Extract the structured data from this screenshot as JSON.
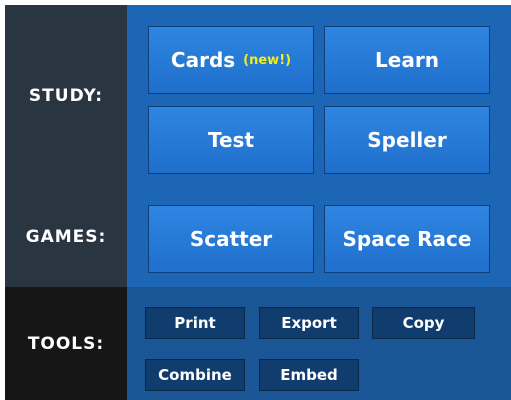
{
  "study": {
    "label": "STUDY:",
    "buttons": {
      "cards": "Cards",
      "cards_badge": "(new!)",
      "learn": "Learn",
      "test": "Test",
      "speller": "Speller"
    }
  },
  "games": {
    "label": "GAMES:",
    "buttons": {
      "scatter": "Scatter",
      "space_race": "Space Race"
    }
  },
  "tools": {
    "label": "TOOLS:",
    "buttons": {
      "print": "Print",
      "export": "Export",
      "copy": "Copy",
      "combine": "Combine",
      "embed": "Embed"
    }
  },
  "colors": {
    "label_bg": "#2a3542",
    "tools_label_bg": "#161616",
    "content_bg": "#1d66b5",
    "tools_content_bg": "#1a5696",
    "big_button": "#2a7fd9",
    "small_button": "#113d6e",
    "badge": "#f2ee1c"
  }
}
